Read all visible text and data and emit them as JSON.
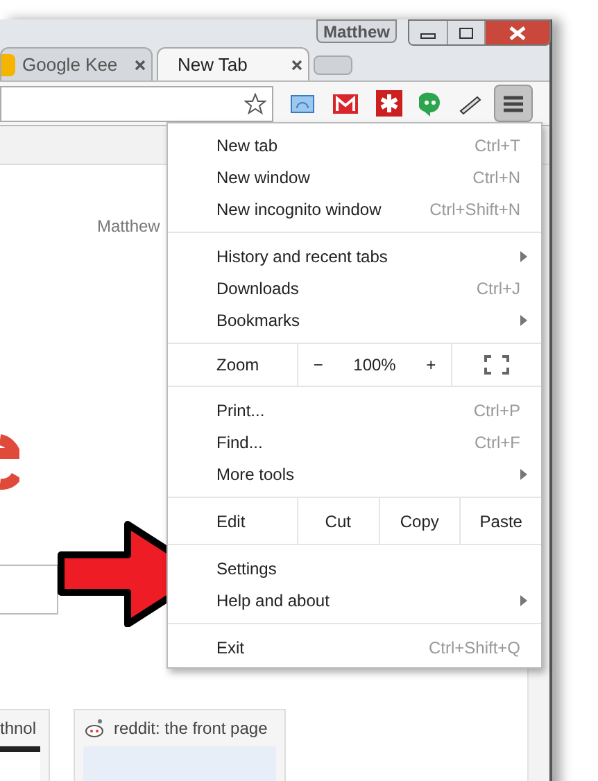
{
  "window": {
    "profile_button": "Matthew"
  },
  "tabs": [
    {
      "label": "Google Kee",
      "selected": false
    },
    {
      "label": "New Tab",
      "selected": true
    }
  ],
  "page": {
    "profile_name": "Matthew",
    "tiles": [
      {
        "title": "thnol"
      },
      {
        "title": "reddit: the front page"
      }
    ]
  },
  "menu": {
    "items": [
      {
        "kind": "item",
        "label": "New tab",
        "shortcut": "Ctrl+T",
        "submenu": false
      },
      {
        "kind": "item",
        "label": "New window",
        "shortcut": "Ctrl+N",
        "submenu": false
      },
      {
        "kind": "item",
        "label": "New incognito window",
        "shortcut": "Ctrl+Shift+N",
        "submenu": false
      },
      {
        "kind": "divider"
      },
      {
        "kind": "item",
        "label": "History and recent tabs",
        "submenu": true
      },
      {
        "kind": "item",
        "label": "Downloads",
        "shortcut": "Ctrl+J",
        "submenu": false
      },
      {
        "kind": "item",
        "label": "Bookmarks",
        "submenu": true
      },
      {
        "kind": "divider"
      },
      {
        "kind": "zoom",
        "label": "Zoom",
        "minus": "−",
        "value": "100%",
        "plus": "+"
      },
      {
        "kind": "divider"
      },
      {
        "kind": "item",
        "label": "Print...",
        "shortcut": "Ctrl+P",
        "submenu": false
      },
      {
        "kind": "item",
        "label": "Find...",
        "shortcut": "Ctrl+F",
        "submenu": false
      },
      {
        "kind": "item",
        "label": "More tools",
        "submenu": true
      },
      {
        "kind": "divider"
      },
      {
        "kind": "edit",
        "label": "Edit",
        "buttons": [
          "Cut",
          "Copy",
          "Paste"
        ]
      },
      {
        "kind": "divider"
      },
      {
        "kind": "item",
        "label": "Settings",
        "submenu": false
      },
      {
        "kind": "item",
        "label": "Help and about",
        "submenu": true
      },
      {
        "kind": "divider"
      },
      {
        "kind": "item",
        "label": "Exit",
        "shortcut": "Ctrl+Shift+Q",
        "submenu": false
      }
    ]
  }
}
